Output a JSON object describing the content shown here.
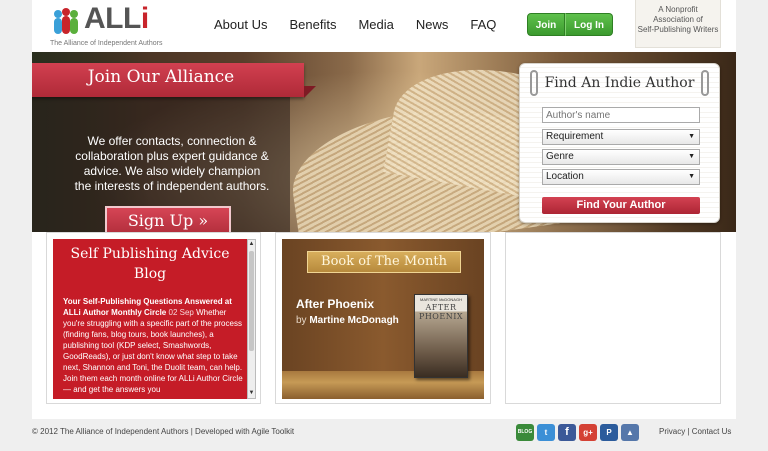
{
  "header": {
    "logo_text_main": "ALL",
    "logo_text_accent": "i",
    "logo_tagline": "The Alliance of Independent Authors",
    "nav": [
      "About Us",
      "Benefits",
      "Media",
      "News",
      "FAQ"
    ],
    "join_label": "Join",
    "login_label": "Log In",
    "nonprofit_line1": "A Nonprofit",
    "nonprofit_line2": "Association of",
    "nonprofit_line3": "Self-Publishing Writers"
  },
  "hero": {
    "ribbon_title": "Join Our Alliance",
    "description": "We offer contacts, connection & collaboration plus expert guidance & advice. We also widely champion the interests of independent authors.",
    "signup_label": "Sign Up »"
  },
  "finder": {
    "title": "Find An Indie Author",
    "name_placeholder": "Author's name",
    "requirement": "Requirement",
    "genre": "Genre",
    "location": "Location",
    "submit_label": "Find Your Author"
  },
  "blog": {
    "title": "Self Publishing Advice Blog",
    "post_title": "Your Self-Publishing Questions Answered at ALLi Author Monthly Circle",
    "post_date": "02 Sep",
    "post_body": "Whether you're struggling with a specific part of the process (finding fans, blog tours, book launches), a publishing tool (KDP select, Smashwords, GoodReads), or just don't know what step to take next, Shannon and Toni, the Duolit team, can help. Join them each month online for ALLi Author Circle — and get the answers you"
  },
  "book_of_month": {
    "banner": "Book of The Month",
    "title": "After Phoenix",
    "by": "by",
    "author": "Martine McDonagh",
    "cover_author": "MARTINE McDONAGH",
    "cover_title": "AFTER PHOENIX"
  },
  "footer": {
    "copyright": "© 2012 The Alliance of Independent Authors | Developed with Agile Toolkit",
    "privacy": "Privacy",
    "separator": "|",
    "contact": "Contact Us",
    "social_icons": [
      "blog-icon",
      "twitter-icon",
      "facebook-icon",
      "google-plus-icon",
      "pinterest-icon",
      "back-to-top-icon"
    ]
  },
  "colors": {
    "brand_red": "#c8242b",
    "join_green": "#4cae3a",
    "finder_button": "#c0303e"
  }
}
